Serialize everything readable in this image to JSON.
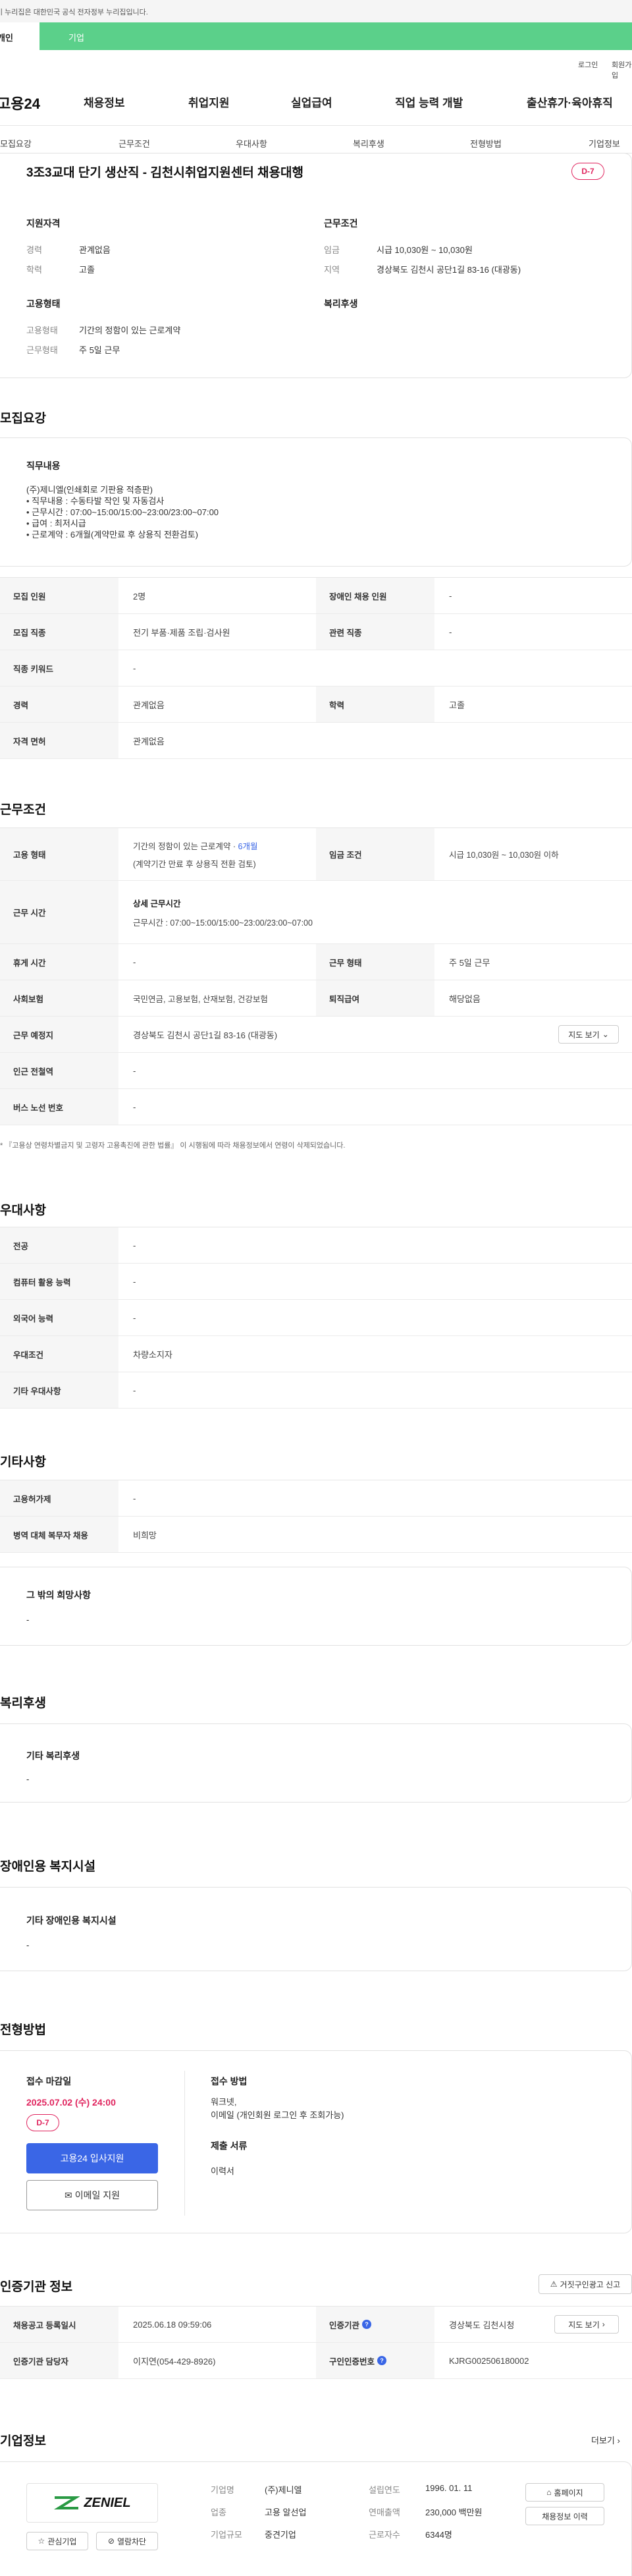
{
  "gov_banner": "이 누리집은 대한민국 공식 전자정부 누리집입니다.",
  "tabs": [
    "개인",
    "기업"
  ],
  "util": {
    "login": "로그인",
    "join": "회원가입"
  },
  "logo": "고용24",
  "nav": [
    "채용정보",
    "취업지원",
    "실업급여",
    "직업 능력 개발",
    "출산휴가·육아휴직"
  ],
  "subnav": [
    "모집요강",
    "근무조건",
    "우대사항",
    "복리후생",
    "전형방법",
    "기업정보"
  ],
  "job": {
    "title": "3조3교대 단기 생산직 - 김천시취업지원센터 채용대행",
    "dday": "D-7",
    "qual_title": "지원자격",
    "qual": [
      {
        "k": "경력",
        "v": "관계없음"
      },
      {
        "k": "학력",
        "v": "고졸"
      }
    ],
    "cond_title": "근무조건",
    "cond": [
      {
        "k": "임금",
        "v": "시급 10,030원 ~ 10,030원"
      },
      {
        "k": "지역",
        "v": "경상북도 김천시 공단1길 83-16 (대광동)"
      }
    ],
    "emp_title": "고용형태",
    "emp": [
      {
        "k": "고용형태",
        "v": "기간의 정함이 있는 근로계약"
      },
      {
        "k": "근무형태",
        "v": "주 5일 근무"
      }
    ],
    "benefit_title": "복리후생"
  },
  "recruit": {
    "title": "모집요강",
    "duty_title": "직무내용",
    "duty_lines": [
      "(주)제니엘(인쇄회로 기판용 적층판)",
      "• 직무내용 : 수동타발 작인 및 자동검사",
      "• 근무시간 : 07:00~15:00/15:00~23:00/23:00~07:00",
      "• 급여 : 최저시급",
      "• 근로계약 : 6개월(계약만료 후 상용직 전환검토)"
    ],
    "rows": [
      {
        "h1": "모집 인원",
        "v1": "2명",
        "h2": "장애인 채용 인원",
        "v2": "-"
      },
      {
        "h1": "모집 직종",
        "v1": "전기 부품·제품 조립·검사원",
        "h2": "관련 직종",
        "v2": "-"
      },
      {
        "h1": "직종 키워드",
        "v1": "-"
      },
      {
        "h1": "경력",
        "v1": "관계없음",
        "h2": "학력",
        "v2": "고졸"
      },
      {
        "h1": "자격 면허",
        "v1": "관계없음"
      }
    ]
  },
  "work": {
    "title": "근무조건",
    "emp_type_label": "고용 형태",
    "emp_type_value": "기간의 정함이 있는 근로계약 · ",
    "emp_type_link": "6개월",
    "emp_type_note": "(계약기간 만료 후 상용직 전환 검토)",
    "wage_label": "임금 조건",
    "wage_value": "시급 10,030원 ~ 10,030원 이하",
    "hours_label": "근무 시간",
    "hours_sub": "상세 근무시간",
    "hours_value": "근무시간 : 07:00~15:00/15:00~23:00/23:00~07:00",
    "rows": [
      {
        "h1": "휴게 시간",
        "v1": "-",
        "h2": "근무 형태",
        "v2": "주 5일 근무"
      },
      {
        "h1": "사회보험",
        "v1": "국민연금, 고용보험, 산재보험, 건강보험",
        "h2": "퇴직급여",
        "v2": "해당없음"
      }
    ],
    "place_label": "근무 예정지",
    "place_value": "경상북도 김천시 공단1길 83-16 (대광동)",
    "map_btn": "지도 보기",
    "rows2": [
      {
        "h": "인근 전철역",
        "v": "-"
      },
      {
        "h": "버스 노선 번호",
        "v": "-"
      }
    ],
    "notice": "* 『고용상 연령차별금지 및 고령자 고용촉진에 관한 법률』 이 시행됨에 따라 채용정보에서 연령이 삭제되었습니다."
  },
  "pref": {
    "title": "우대사항",
    "rows": [
      {
        "h": "전공",
        "v": "-"
      },
      {
        "h": "컴퓨터 활용 능력",
        "v": "-"
      },
      {
        "h": "외국어 능력",
        "v": "-"
      },
      {
        "h": "우대조건",
        "v": "차량소지자"
      },
      {
        "h": "기타 우대사항",
        "v": "-"
      }
    ]
  },
  "etc": {
    "title": "기타사항",
    "rows": [
      {
        "h": "고용허가제",
        "v": "-"
      },
      {
        "h": "병역 대체 복무자 채용",
        "v": "비희망"
      }
    ],
    "box_title": "그 밖의 희망사항",
    "box_value": "-"
  },
  "welfare": {
    "title": "복리후생",
    "box_title": "기타 복리후생",
    "box_value": "-"
  },
  "disab": {
    "title": "장애인용 복지시설",
    "box_title": "기타 장애인용 복지시설",
    "box_value": "-"
  },
  "process": {
    "title": "전형방법",
    "deadline_title": "접수 마감일",
    "deadline_value": "2025.07.02 (수) 24:00",
    "dday": "D-7",
    "apply_btn": "고용24 입사지원",
    "email_btn": "이메일 지원",
    "method_title": "접수 방법",
    "method_lines": [
      "워크넷,",
      "이메일 (개인회원 로그인 후 조회가능)"
    ],
    "docs_title": "제출 서류",
    "docs_value": "이력서"
  },
  "cert": {
    "title": "인증기관 정보",
    "report_btn": "거짓구인광고 신고",
    "rows": [
      {
        "h1": "채용공고 등록일시",
        "v1": "2025.06.18 09:59:06",
        "h2": "인증기관",
        "v2": "경상북도 김천시청"
      },
      {
        "h1": "인증기관 담당자",
        "v1": "이지연(054-429-8926)",
        "h2": "구인인증번호",
        "v2": "KJRG002506180002"
      }
    ],
    "map_btn": "지도 보기"
  },
  "company": {
    "title": "기업정보",
    "more": "더보기",
    "logo_text": "ZENIEL",
    "fav_btn": "관심기업",
    "block_btn": "열람차단",
    "info": [
      {
        "k": "기업명",
        "v": "(주)제니엘"
      },
      {
        "k": "업종",
        "v": "고용 알선업"
      },
      {
        "k": "기업규모",
        "v": "중견기업"
      },
      {
        "k": "설립연도",
        "v": "1996. 01. 11"
      },
      {
        "k": "연매출액",
        "v": "230,000 백만원"
      },
      {
        "k": "근로자수",
        "v": "6344명"
      }
    ],
    "home_btn": "홈페이지",
    "history_btn": "채용정보 이력"
  },
  "colors": {
    "green": "#5bd08a",
    "dday_red": "#e0245e",
    "blue": "#3a66e6"
  }
}
